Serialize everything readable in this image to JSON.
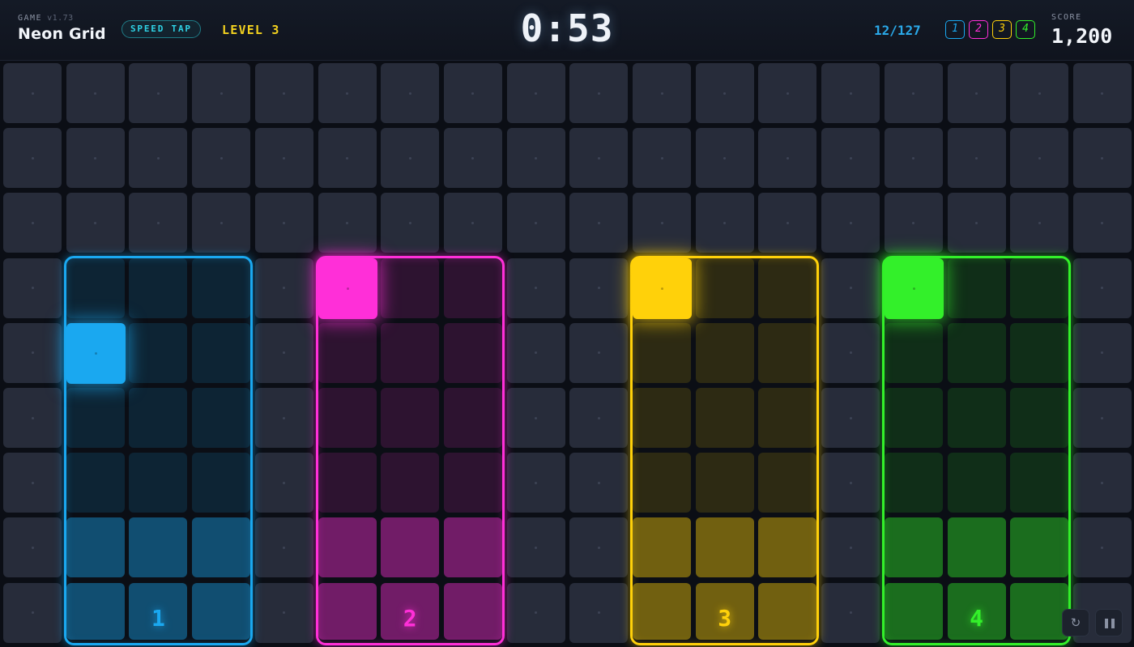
{
  "hud": {
    "game_label": "GAME",
    "version": "v1.73",
    "title": "Neon Grid",
    "mode": "SPEED TAP",
    "level": "LEVEL 3",
    "timer": "0:53",
    "progress": "12/127",
    "score_label": "SCORE",
    "score": "1,200"
  },
  "keys": [
    {
      "label": "1",
      "color": "#1aa8f0"
    },
    {
      "label": "2",
      "color": "#ff2fd8"
    },
    {
      "label": "3",
      "color": "#ffd10a"
    },
    {
      "label": "4",
      "color": "#33f02a"
    }
  ],
  "grid": {
    "columns": 18,
    "rows": 9
  },
  "lanes": [
    {
      "label": "1",
      "color": "#1aa8f0",
      "rgb": "26,168,240",
      "columns": [
        1,
        3
      ],
      "active_tile": {
        "column": 1,
        "row": 4
      }
    },
    {
      "label": "2",
      "color": "#ff2fd8",
      "rgb": "255,47,216",
      "columns": [
        5,
        7
      ],
      "active_tile": {
        "column": 5,
        "row": 3
      }
    },
    {
      "label": "3",
      "color": "#ffd10a",
      "rgb": "255,209,10",
      "columns": [
        10,
        12
      ],
      "active_tile": {
        "column": 10,
        "row": 3
      }
    },
    {
      "label": "4",
      "color": "#33f02a",
      "rgb": "51,240,42",
      "columns": [
        14,
        16
      ],
      "active_tile": {
        "column": 14,
        "row": 3
      }
    }
  ],
  "lane_start_row": 3,
  "controls": {
    "restart_icon": "↻",
    "pause_icon": "❚❚"
  }
}
